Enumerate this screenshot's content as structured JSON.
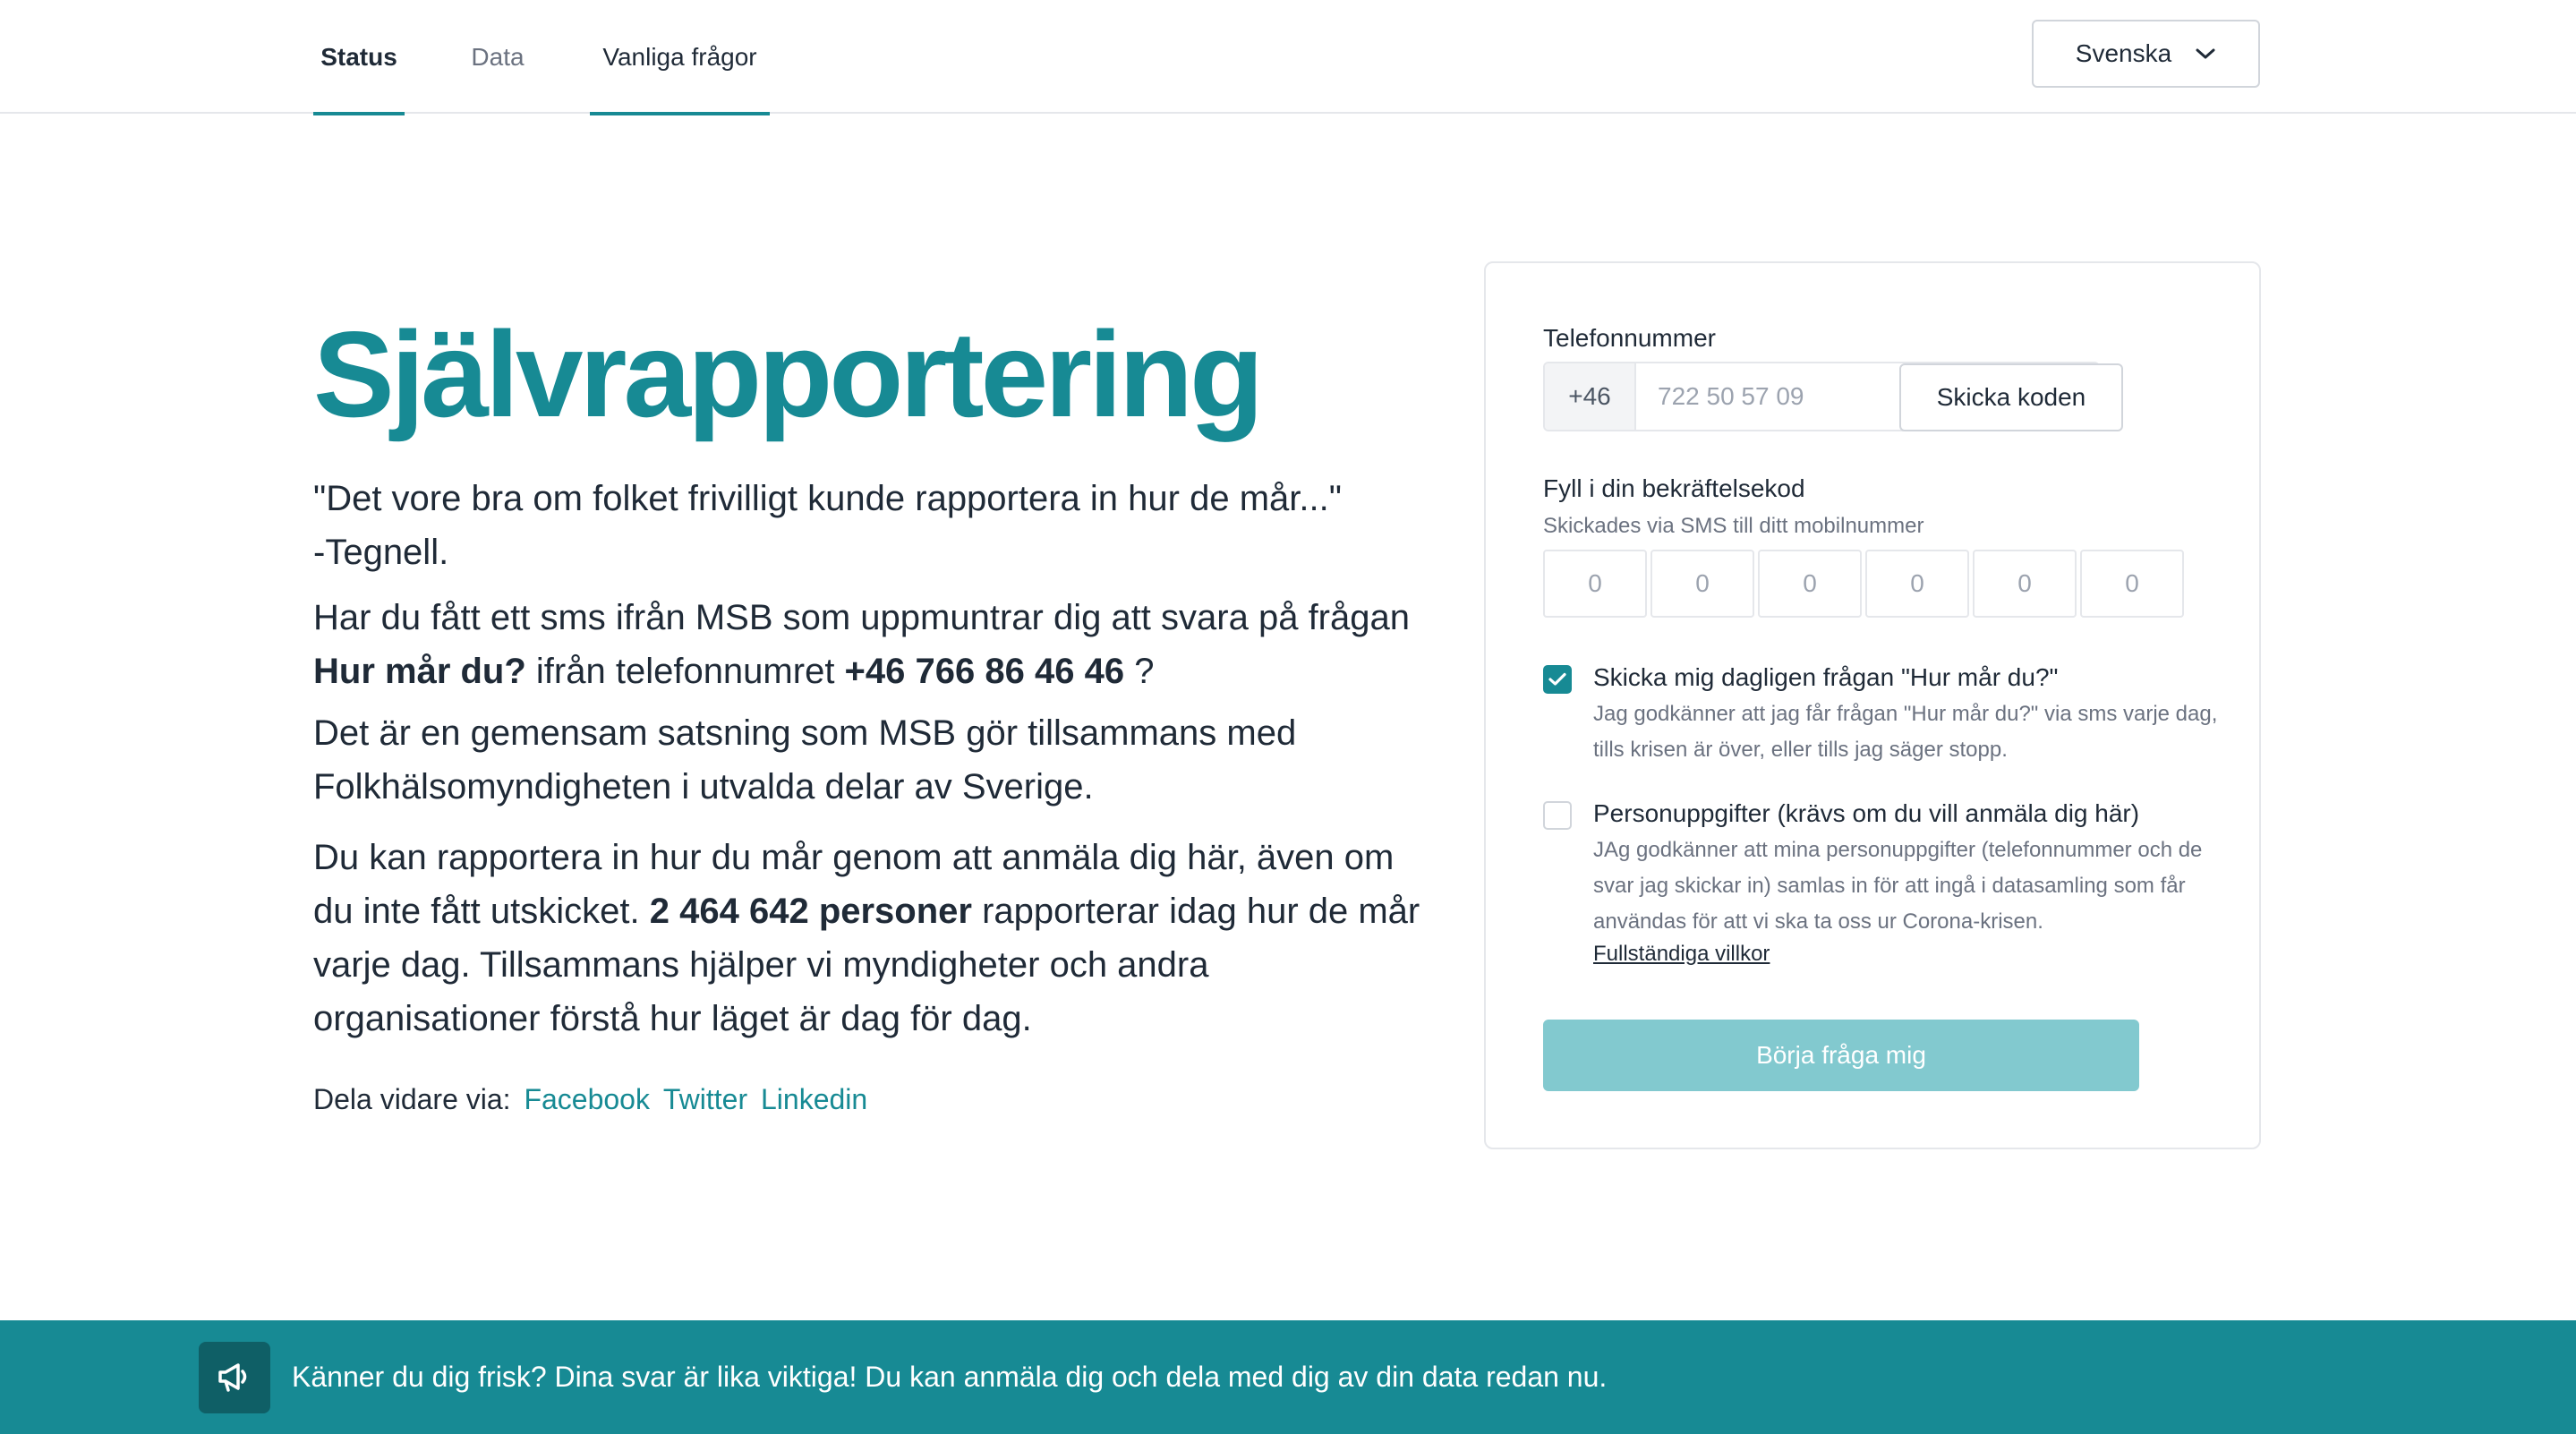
{
  "nav": {
    "tabs": [
      {
        "label": "Status"
      },
      {
        "label": "Data"
      },
      {
        "label": "Vanliga frågor"
      }
    ],
    "language": "Svenska"
  },
  "hero": {
    "title": "Självrapportering",
    "quote_line1": "\"Det vore bra om folket frivilligt kunde rapportera in hur de mår...\"",
    "quote_line2": "-Tegnell.",
    "p2_part1": "Har du fått ett sms ifrån MSB som uppmuntrar dig att svara på frågan ",
    "p2_bold1": "Hur mår du?",
    "p2_part2": " ifrån telefonnumret ",
    "p2_bold2": "+46 766 86 46 46",
    "p2_part3": " ?",
    "p3": "Det är en gemensam satsning som MSB gör tillsammans med Folkhälsomyndigheten i utvalda delar av Sverige.",
    "p4_part1": "Du kan rapportera in hur du mår genom att anmäla dig här, även om du inte fått utskicket. ",
    "p4_bold": "2 464 642 personer",
    "p4_part2": " rapporterar idag hur de mår varje dag. Tillsammans hjälper vi myndigheter och andra organisationer förstå hur läget är dag för dag.",
    "share_label": "Dela vidare via:",
    "share_links": [
      "Facebook",
      "Twitter",
      "Linkedin"
    ]
  },
  "form": {
    "phone_label": "Telefonnummer",
    "phone_prefix": "+46",
    "phone_placeholder": "722 50 57 09",
    "send_code_label": "Skicka koden",
    "code_label": "Fyll i din bekräftelsekod",
    "code_sublabel": "Skickades via SMS till ditt mobilnummer",
    "code_placeholders": [
      "0",
      "0",
      "0",
      "0",
      "0",
      "0"
    ],
    "daily_checkbox": {
      "checked": true,
      "title": "Skicka mig dagligen frågan \"Hur mår du?\"",
      "desc": "Jag godkänner att jag får frågan \"Hur mår du?\" via sms varje dag, tills krisen är över, eller tills jag säger stopp."
    },
    "personal_checkbox": {
      "checked": false,
      "title": "Personuppgifter (krävs om du vill anmäla dig här)",
      "desc": "JAg godkänner att mina personuppgifter (telefonnummer och de svar jag skickar in) samlas in för att ingå i datasamling som får användas för att vi ska ta oss ur Corona-krisen.",
      "terms_link": "Fullständiga villkor"
    },
    "start_button": "Börja fråga mig"
  },
  "banner": {
    "icon": "megaphone-icon",
    "text": "Känner du dig frisk? Dina svar är lika viktiga! Du kan anmäla dig och dela med dig av din data redan nu."
  },
  "colors": {
    "accent": "#178a94",
    "accent_light": "#82c9cf",
    "banner_icon_bg": "#0f5f66",
    "text": "#1f2a37",
    "muted": "#6b7280"
  }
}
